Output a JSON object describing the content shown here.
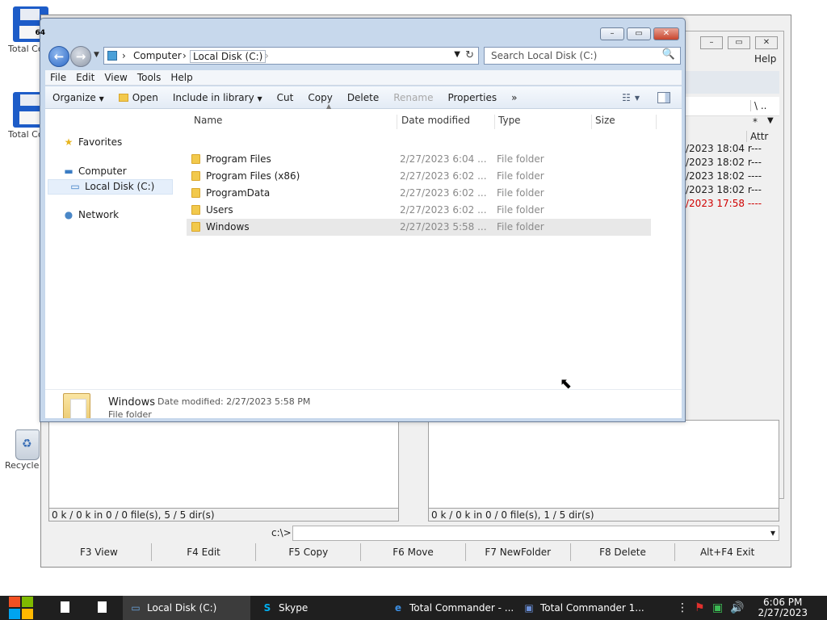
{
  "desktop": {
    "icons": [
      {
        "label": "Total Commander",
        "badge": "64"
      },
      {
        "label": "Total Commander"
      },
      {
        "label": "Recycle Bin"
      }
    ]
  },
  "total_commander": {
    "menu_help": "Help",
    "path_text": "\\ ..",
    "filter_text": "*",
    "attr_header": "Attr",
    "rows": [
      {
        "date": "/2023 18:04",
        "attr": "r---"
      },
      {
        "date": "/2023 18:02",
        "attr": "r---"
      },
      {
        "date": "/2023 18:02",
        "attr": "----"
      },
      {
        "date": "/2023 18:02",
        "attr": "r---"
      },
      {
        "date": "/2023 17:58",
        "attr": "----"
      }
    ],
    "left_status": "0 k / 0 k in 0 / 0 file(s), 5 / 5 dir(s)",
    "right_status": "0 k / 0 k in 0 / 0 file(s), 1 / 5 dir(s)",
    "command_label": "c:\\>",
    "fkeys": [
      "F3 View",
      "F4 Edit",
      "F5 Copy",
      "F6 Move",
      "F7 NewFolder",
      "F8 Delete",
      "Alt+F4 Exit"
    ]
  },
  "explorer": {
    "breadcrumb": [
      "Computer",
      "Local Disk (C:)"
    ],
    "search_placeholder": "Search Local Disk (C:)",
    "menu": [
      "File",
      "Edit",
      "View",
      "Tools",
      "Help"
    ],
    "toolbar": {
      "organize": "Organize",
      "open": "Open",
      "include": "Include in library",
      "cut": "Cut",
      "copy": "Copy",
      "delete": "Delete",
      "rename": "Rename",
      "properties": "Properties",
      "more": "»"
    },
    "nav": {
      "favorites": "Favorites",
      "computer": "Computer",
      "local_disk": "Local Disk (C:)",
      "network": "Network"
    },
    "columns": {
      "name": "Name",
      "date": "Date modified",
      "type": "Type",
      "size": "Size"
    },
    "files": [
      {
        "name": "Program Files",
        "date": "2/27/2023 6:04 ...",
        "type": "File folder"
      },
      {
        "name": "Program Files (x86)",
        "date": "2/27/2023 6:02 ...",
        "type": "File folder"
      },
      {
        "name": "ProgramData",
        "date": "2/27/2023 6:02 ...",
        "type": "File folder"
      },
      {
        "name": "Users",
        "date": "2/27/2023 6:02 ...",
        "type": "File folder"
      },
      {
        "name": "Windows",
        "date": "2/27/2023 5:58 ...",
        "type": "File folder"
      }
    ],
    "details": {
      "name": "Windows",
      "date_label": "Date modified: 2/27/2023 5:58 PM",
      "type": "File folder"
    }
  },
  "taskbar": {
    "tasks": [
      {
        "label": "Local Disk (C:)"
      },
      {
        "label": "Skype"
      },
      {
        "label": "Total Commander - ..."
      },
      {
        "label": "Total Commander 1..."
      }
    ],
    "time": "6:06 PM",
    "date": "2/27/2023"
  }
}
